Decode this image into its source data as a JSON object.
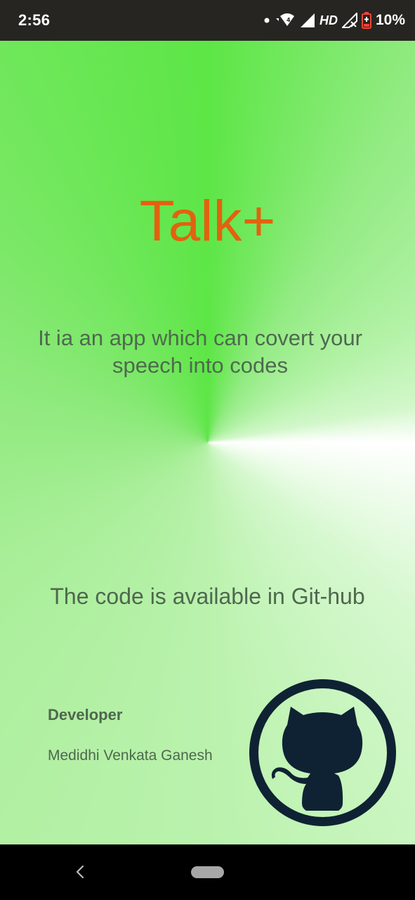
{
  "status_bar": {
    "time": "2:56",
    "network_type": "HD",
    "battery_percent": "10%",
    "icons": [
      "notification-dot-icon",
      "wifi-icon",
      "signal-icon",
      "signal-no-service-icon",
      "battery-low-icon"
    ]
  },
  "app": {
    "title": "Talk+",
    "description": "It ia an app which can covert your speech into codes",
    "github_text": "The code is available in Git-hub",
    "developer_heading": "Developer",
    "developer_name": "Medidhi Venkata Ganesh",
    "github_icon": "github-octocat-icon"
  },
  "colors": {
    "title": "#e2620f",
    "text": "#4f674f",
    "gradient_green": "#5de646",
    "github_logo": "#0f2233"
  },
  "nav_bar": {
    "icons": [
      "back-icon",
      "home-pill-icon"
    ]
  }
}
